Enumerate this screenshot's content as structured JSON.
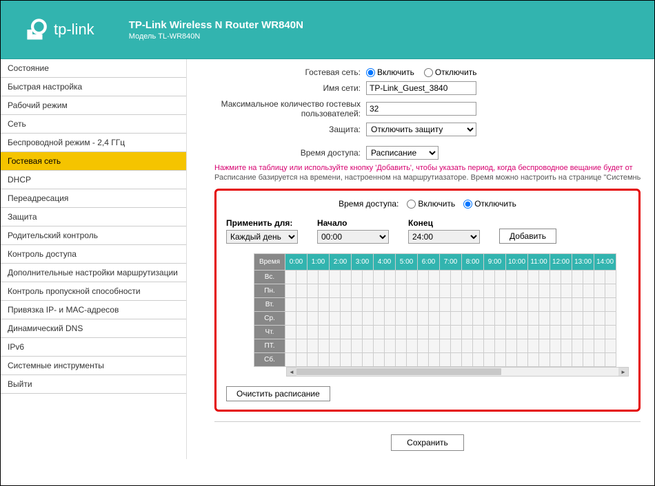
{
  "header": {
    "brand": "tp-link",
    "title": "TP-Link Wireless N Router WR840N",
    "subtitle": "Модель TL-WR840N"
  },
  "sidebar": {
    "items": [
      "Состояние",
      "Быстрая настройка",
      "Рабочий режим",
      "Сеть",
      "Беспроводной режим - 2,4 ГГц",
      "Гостевая сеть",
      "DHCP",
      "Переадресация",
      "Защита",
      "Родительский контроль",
      "Контроль доступа",
      "Дополнительные настройки маршрутизации",
      "Контроль пропускной способности",
      "Привязка IP- и MAC-адресов",
      "Динамический DNS",
      "IPv6",
      "Системные инструменты",
      "Выйти"
    ],
    "activeIndex": 5
  },
  "form": {
    "guestNetLabel": "Гостевая сеть:",
    "enableLabel": "Включить",
    "disableLabel": "Отключить",
    "ssidLabel": "Имя сети:",
    "ssidValue": "TP-Link_Guest_3840",
    "maxGuestsLabel": "Максимальное количество гостевых пользователей:",
    "maxGuestsValue": "32",
    "securityLabel": "Защита:",
    "securityValue": "Отключить защиту",
    "accessTimeLabel": "Время доступа:",
    "accessTimeValue": "Расписание"
  },
  "hints": {
    "line1": "Нажмите на таблицу или используйте кнопку 'Добавить', чтобы указать период, когда беспроводное вещание будет от",
    "line2": "Расписание базируется на времени, настроенном на маршрутиазаторе. Время можно настроить на странице \"Системные и"
  },
  "schedule": {
    "accessTimeLabel": "Время доступа:",
    "enableLabel": "Включить",
    "disableLabel": "Отключить",
    "applyLabel": "Применить для:",
    "applyValue": "Каждый день",
    "startLabel": "Начало",
    "startValue": "00:00",
    "endLabel": "Конец",
    "endValue": "24:00",
    "addLabel": "Добавить",
    "timeHeader": "Время",
    "hours": [
      "0:00",
      "1:00",
      "2:00",
      "3:00",
      "4:00",
      "5:00",
      "6:00",
      "7:00",
      "8:00",
      "9:00",
      "10:00",
      "11:00",
      "12:00",
      "13:00",
      "14:00"
    ],
    "days": [
      "Вс.",
      "Пн.",
      "Вт.",
      "Ср.",
      "Чт.",
      "ПТ.",
      "Сб."
    ],
    "clearLabel": "Очистить расписание"
  },
  "saveLabel": "Сохранить"
}
